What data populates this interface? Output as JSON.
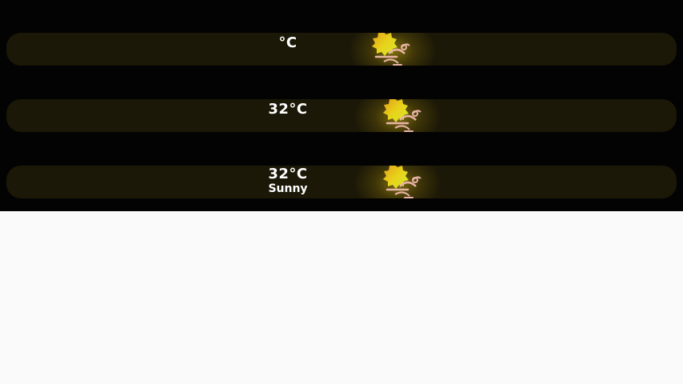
{
  "widgets": [
    {
      "temperature": "°C",
      "condition": "",
      "icon": "sun-wind-icon"
    },
    {
      "temperature": "32°C",
      "condition": "",
      "icon": "sun-wind-icon"
    },
    {
      "temperature": "32°C",
      "condition": "Sunny",
      "icon": "sun-wind-icon"
    }
  ],
  "colors": {
    "background": "#030303",
    "bar": "#1b1807",
    "page": "#fafafa",
    "text": "#ffffff",
    "sun_top": "#e39a1c",
    "sun_mid": "#e8d21a",
    "sun_bottom": "#d6e82e",
    "wind": "#e8b4a6"
  }
}
